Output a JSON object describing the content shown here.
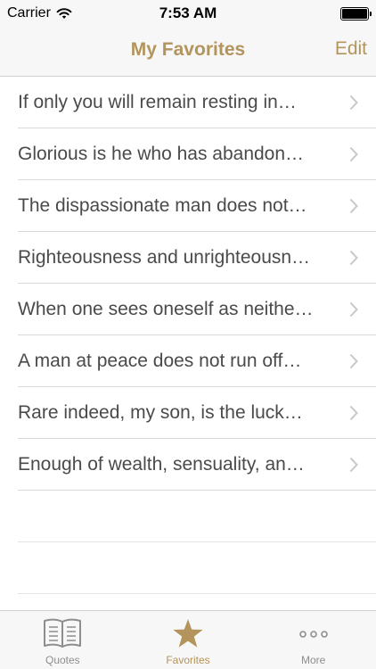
{
  "status_bar": {
    "carrier": "Carrier",
    "time": "7:53 AM"
  },
  "nav": {
    "title": "My Favorites",
    "edit_label": "Edit"
  },
  "favorites": [
    "If only you will remain resting in…",
    "Glorious is he who has abandon…",
    "The dispassionate man does not…",
    "Righteousness and unrighteousn…",
    "When one sees oneself as neithe…",
    "A man at peace does not run off…",
    "Rare indeed, my son, is the luck…",
    "Enough of wealth, sensuality, an…"
  ],
  "tabs": [
    {
      "label": "Quotes",
      "icon": "book-icon"
    },
    {
      "label": "Favorites",
      "icon": "star-icon",
      "active": true
    },
    {
      "label": "More",
      "icon": "more-icon"
    }
  ],
  "colors": {
    "accent": "#b3945c",
    "text": "#4a4a4a",
    "inactive": "#8e8e8e"
  }
}
